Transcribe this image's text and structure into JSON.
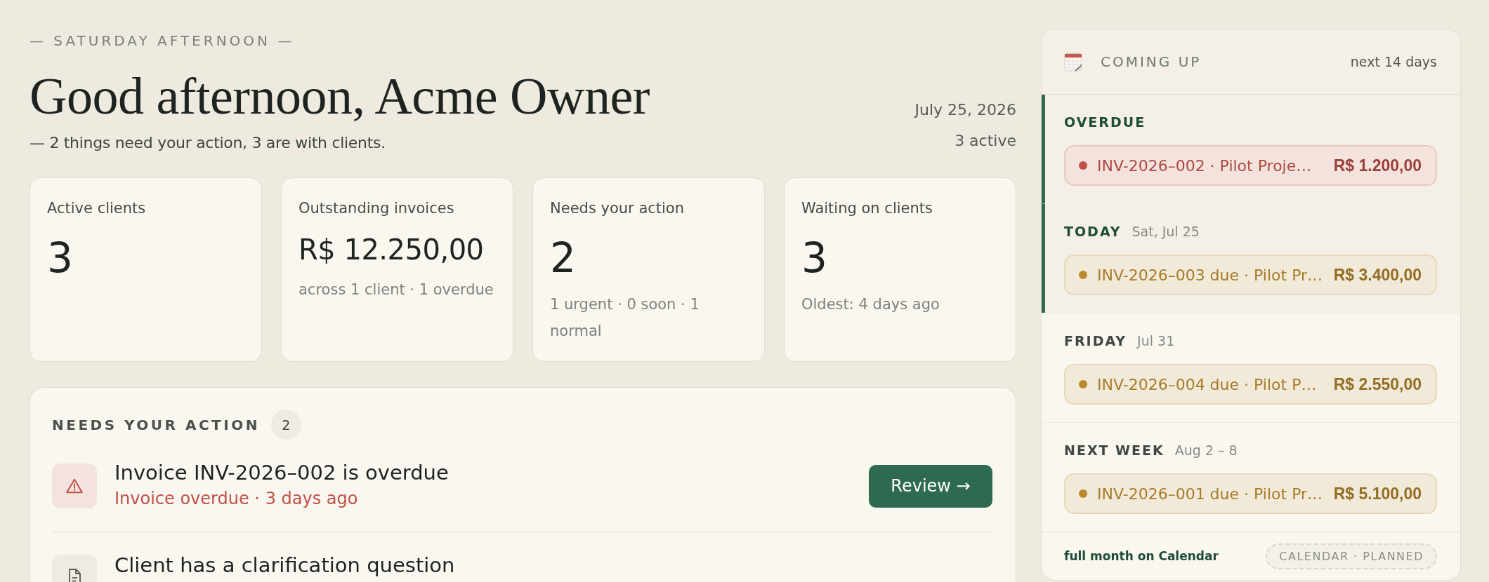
{
  "greeting": {
    "eyebrow": "— SATURDAY AFTERNOON —",
    "title": "Good afternoon, Acme Owner",
    "summary": "— 2 things need your action, 3 are with clients.",
    "date": "July 25, 2026",
    "active_count": "3 active"
  },
  "stats": [
    {
      "kind": "count",
      "label": "Active clients",
      "value": "3"
    },
    {
      "kind": "amount",
      "label": "Outstanding invoices",
      "value": "R$ 12.250,00",
      "note": "across 1 client · 1 overdue"
    },
    {
      "kind": "count",
      "label": "Needs your action",
      "value": "2",
      "note": "1 urgent · 0 soon · 1 normal"
    },
    {
      "kind": "count",
      "label": "Waiting on clients",
      "value": "3",
      "note": "Oldest: 4 days ago"
    }
  ],
  "actions": {
    "title": "NEEDS YOUR ACTION",
    "count": "2",
    "items": [
      {
        "kind": "alert",
        "title": "Invoice INV-2026–002 is overdue",
        "detail": "Invoice overdue · 3 days ago",
        "button": "Review →"
      },
      {
        "kind": "document",
        "title": "Client has a clarification question"
      }
    ]
  },
  "coming_up": {
    "title": "COMING UP",
    "range": "next 14 days",
    "groups": [
      {
        "label": "OVERDUE",
        "emphasized": true,
        "items": [
          {
            "text": "INV-2026–002 · Pilot Proje…",
            "amount": "R$ 1.200,00",
            "color": "#c0504a"
          }
        ]
      },
      {
        "label": "TODAY",
        "date": "Sat, Jul 25",
        "emphasized": true,
        "items": [
          {
            "text": "INV-2026–003 due · Pilot Pr…",
            "amount": "R$ 3.400,00",
            "color": "#b8892e"
          }
        ]
      },
      {
        "label": "FRIDAY",
        "date": "Jul 31",
        "emphasized": false,
        "items": [
          {
            "text": "INV-2026–004 due · Pilot P…",
            "amount": "R$ 2.550,00",
            "color": "#b8892e"
          }
        ]
      },
      {
        "label": "NEXT WEEK",
        "date": "Aug 2 – 8",
        "emphasized": false,
        "items": [
          {
            "text": "INV-2026–001 due · Pilot Pr…",
            "amount": "R$ 5.100,00",
            "color": "#b8892e"
          }
        ]
      }
    ],
    "footer_link": "full month on Calendar",
    "footer_tag": "CALENDAR · PLANNED"
  }
}
